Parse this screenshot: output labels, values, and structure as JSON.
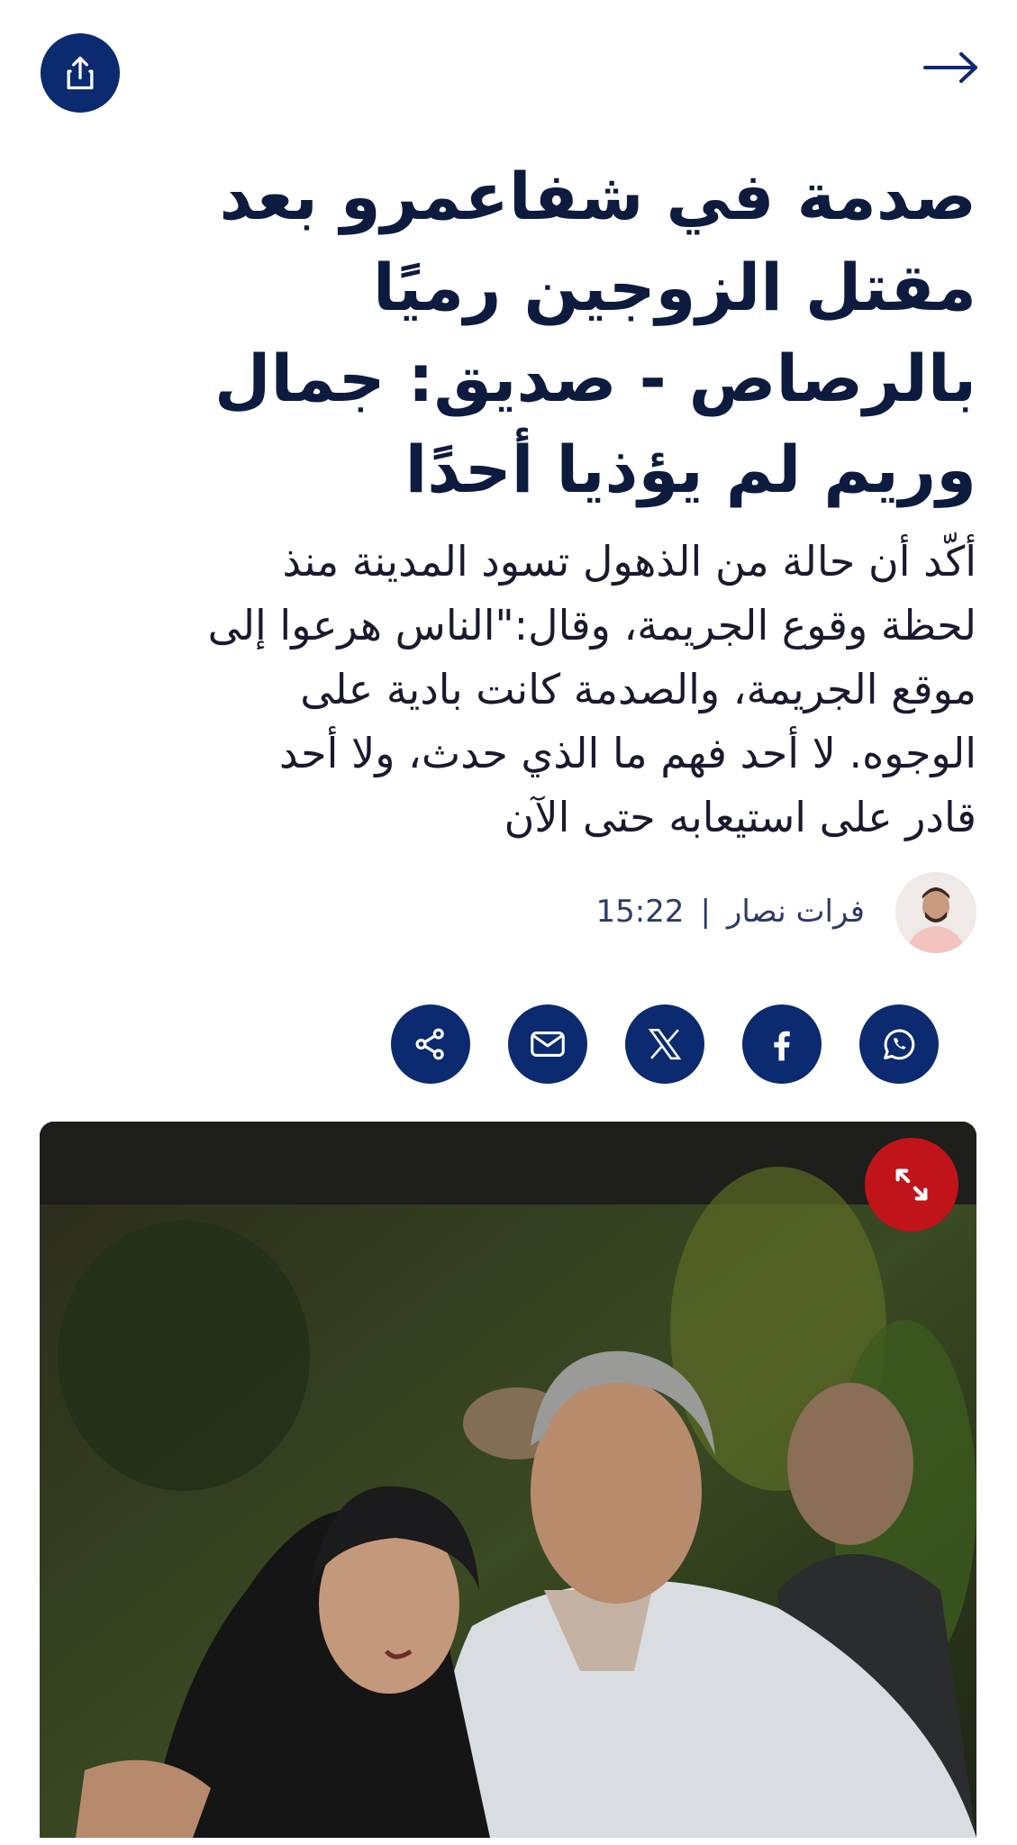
{
  "header": {
    "share_icon": "share-upload-icon",
    "back_icon": "arrow-right-icon"
  },
  "article": {
    "headline_lines": [
      "صدمة في شفاعمرو بعد",
      "مقتل الزوجين رميًا",
      "بالرصاص - صديق: جمال",
      "وريم لم يؤذيا أحدًا"
    ],
    "lede_lines": [
      "أكّد أن حالة من الذهول تسود المدينة منذ",
      "لحظة وقوع الجريمة، وقال:\"الناس هرعوا إلى",
      "موقع الجريمة، والصدمة كانت بادية على",
      "الوجوه. لا أحد فهم ما الذي حدث، ولا أحد",
      "قادر على استيعابه حتى الآن"
    ],
    "author": "فرات نصار",
    "separator": "|",
    "time": "15:22"
  },
  "share_buttons": [
    {
      "name": "whatsapp",
      "icon": "whatsapp-icon"
    },
    {
      "name": "facebook",
      "icon": "facebook-icon"
    },
    {
      "name": "x",
      "icon": "x-icon"
    },
    {
      "name": "email",
      "icon": "mail-icon"
    },
    {
      "name": "share",
      "icon": "share-nodes-icon"
    }
  ],
  "photo": {
    "expand_icon": "expand-arrows-icon"
  },
  "colors": {
    "brand_navy": "#0b2a6f",
    "headline": "#0d1b3e",
    "expand_red": "#c0141a"
  }
}
